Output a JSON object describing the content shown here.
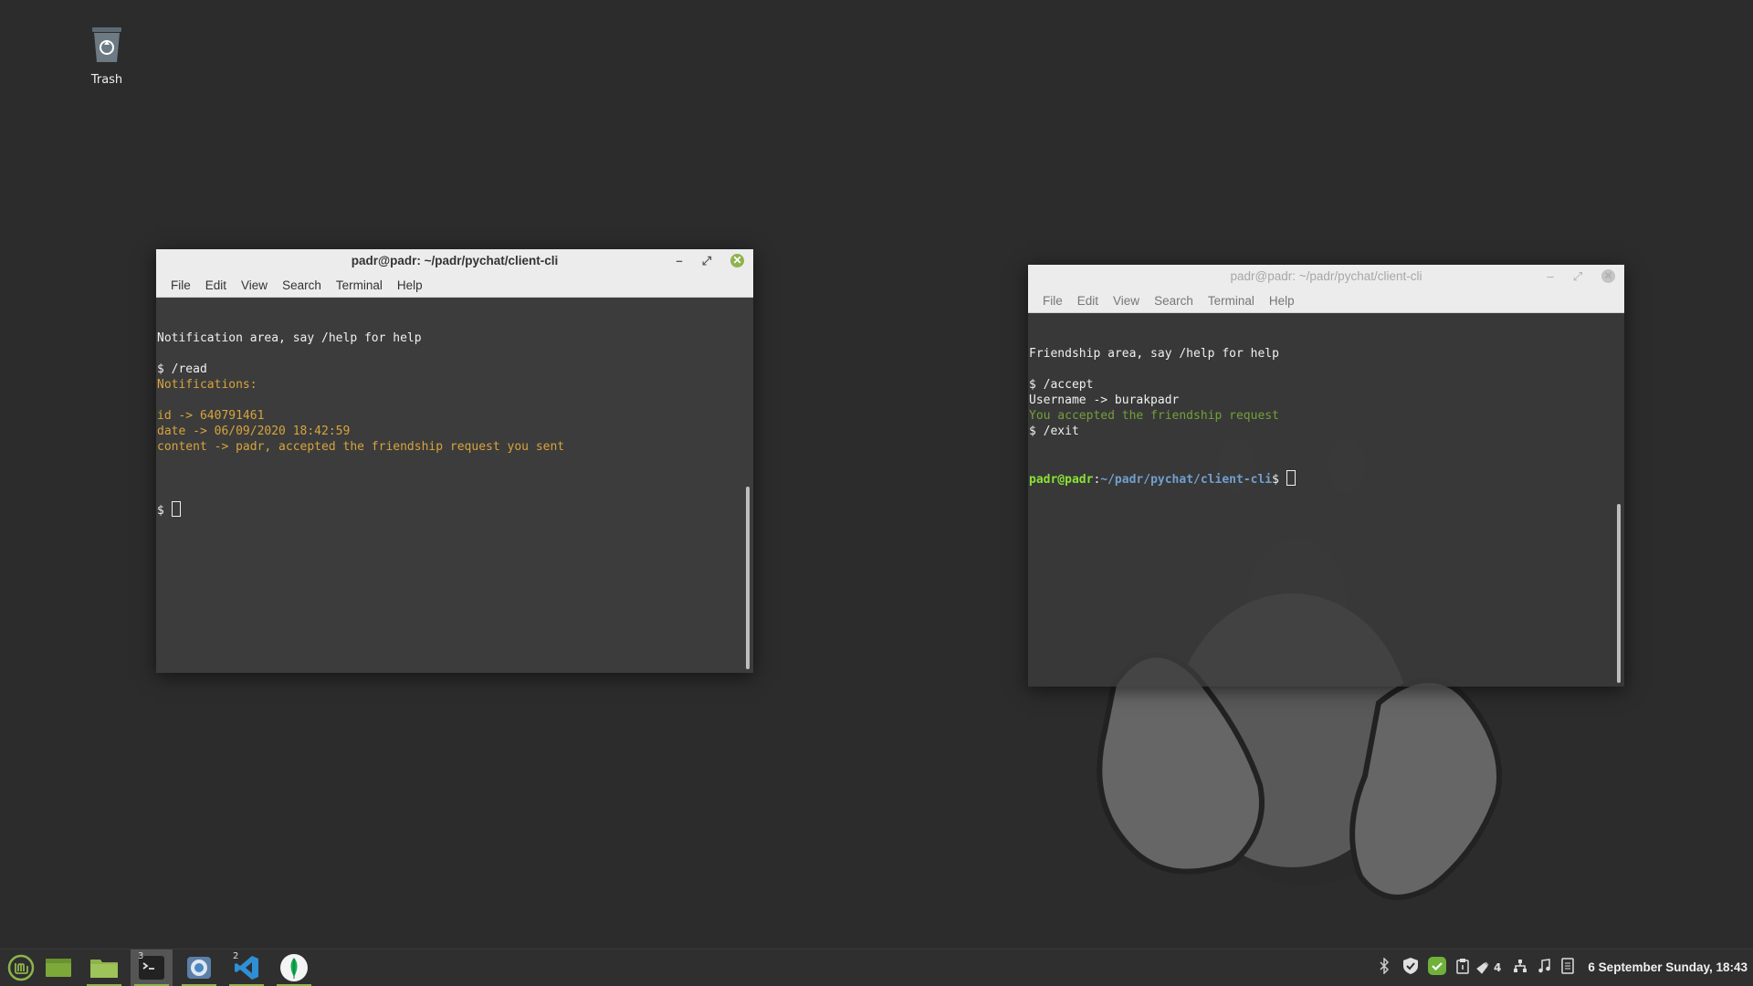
{
  "desktop": {
    "trash_label": "Trash"
  },
  "window_left": {
    "title": "padr@padr: ~/padr/pychat/client-cli",
    "menu": [
      "File",
      "Edit",
      "View",
      "Search",
      "Terminal",
      "Help"
    ],
    "lines": [
      {
        "text": "Notification area, say /help for help",
        "style": "normal"
      },
      {
        "text": "",
        "style": "normal"
      },
      {
        "text": "$ /read",
        "style": "normal"
      },
      {
        "text": "Notifications:",
        "style": "yellow"
      },
      {
        "text": "",
        "style": "normal"
      },
      {
        "text": "id -> 640791461",
        "style": "yellow"
      },
      {
        "text": "date -> 06/09/2020 18:42:59",
        "style": "yellow"
      },
      {
        "text": "content -> padr, accepted the friendship request you sent",
        "style": "yellow"
      },
      {
        "text": "",
        "style": "normal"
      }
    ],
    "prompt": "$ "
  },
  "window_right": {
    "title": "padr@padr: ~/padr/pychat/client-cli",
    "menu": [
      "File",
      "Edit",
      "View",
      "Search",
      "Terminal",
      "Help"
    ],
    "lines": [
      {
        "text": "Friendship area, say /help for help",
        "style": "normal"
      },
      {
        "text": "",
        "style": "normal"
      },
      {
        "text": "$ /accept",
        "style": "normal"
      },
      {
        "text": "Username -> burakpadr",
        "style": "normal"
      },
      {
        "text": "You accepted the friendship request",
        "style": "green"
      },
      {
        "text": "$ /exit",
        "style": "normal"
      }
    ],
    "prompt_user": "padr@padr",
    "prompt_sep": ":",
    "prompt_path": "~/padr/pychat/client-cli",
    "prompt_end": "$ "
  },
  "taskbar": {
    "terminal_badge": "3",
    "vscode_badge": "2",
    "notifications_count": "4",
    "clock": "6 September Sunday, 18:43"
  },
  "colors": {
    "accent": "#8fb34c",
    "terminal_bg": "#3c3c3c",
    "desktop_bg": "#2c2c2c",
    "output_yellow": "#d7a43c",
    "output_green": "#73a03a"
  }
}
